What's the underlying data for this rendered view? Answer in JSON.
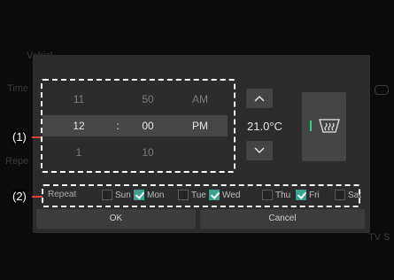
{
  "background": {
    "vehicle_label": "Vehicl",
    "time_label": "Time",
    "repeat_label": "Repe",
    "bottom_right_text": "TV S"
  },
  "picker": {
    "rows": [
      {
        "hour": "11",
        "sep": "",
        "minute": "50",
        "ampm": "AM"
      },
      {
        "hour": "12",
        "sep": ":",
        "minute": "00",
        "ampm": "PM"
      },
      {
        "hour": "1",
        "sep": "",
        "minute": "10",
        "ampm": ""
      }
    ],
    "selected_index": 1
  },
  "climate": {
    "temperature": "21.0°C",
    "up_icon": "chevron-up-icon",
    "down_icon": "chevron-down-icon",
    "defrost_icon": "rear-defrost-icon",
    "defrost_indicator_color": "#2fd38a"
  },
  "repeat": {
    "label": "Repeat",
    "days": [
      {
        "label": "Sun",
        "checked": false
      },
      {
        "label": "Mon",
        "checked": true
      },
      {
        "label": "Tue",
        "checked": false
      },
      {
        "label": "Wed",
        "checked": true
      },
      {
        "label": "Thu",
        "checked": false
      },
      {
        "label": "Fri",
        "checked": true
      },
      {
        "label": "Sat",
        "checked": false
      }
    ]
  },
  "buttons": {
    "ok": "OK",
    "cancel": "Cancel"
  },
  "annotations": {
    "one": "(1)",
    "two": "(2)"
  },
  "colors": {
    "accent": "#3aa390",
    "annotation_line": "#e0413a",
    "dialog_bg": "#2c2c2c"
  }
}
